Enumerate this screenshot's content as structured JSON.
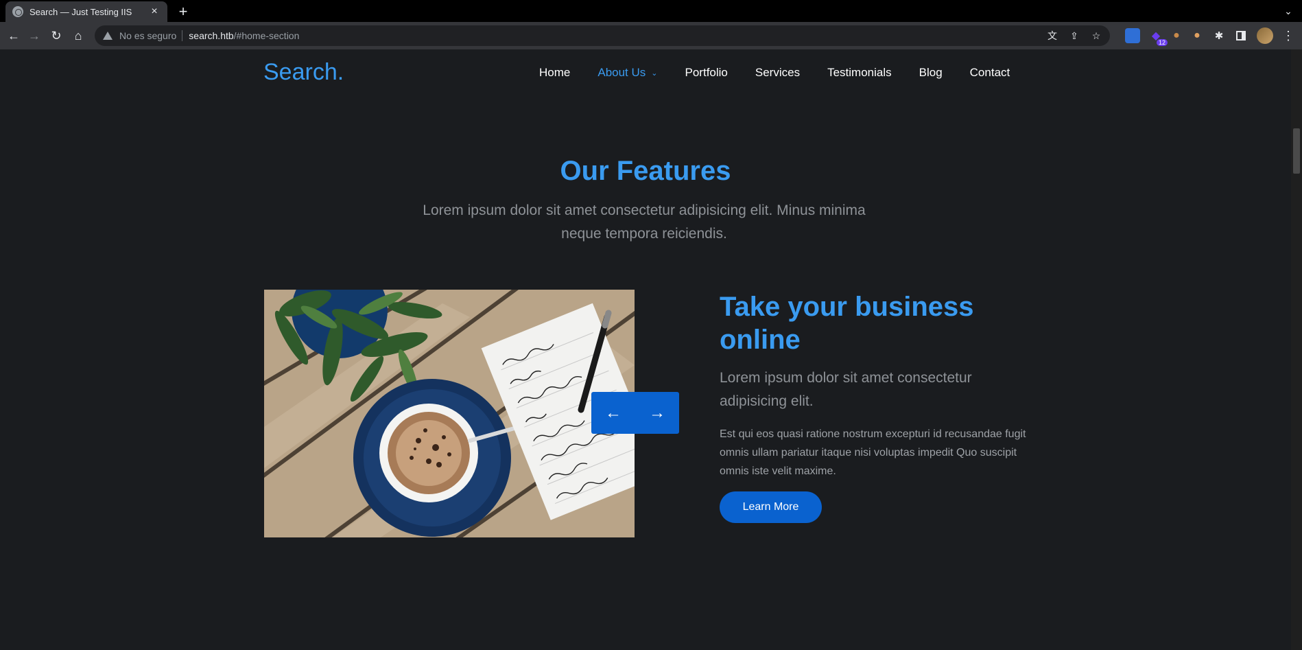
{
  "browser": {
    "tab_title": "Search — Just Testing IIS",
    "tab_close": "×",
    "new_tab": "+",
    "tab_search": "⌄",
    "back": "←",
    "forward": "→",
    "reload": "↻",
    "home": "⌂",
    "security_label": "No es seguro",
    "url_host": "search.htb",
    "url_rest": "/#home-section",
    "translate": "文",
    "share": "⇪",
    "bookmark": "☆",
    "extension_badge": "12",
    "menu": "⋮"
  },
  "site": {
    "logo": "Search.",
    "nav": [
      {
        "label": "Home"
      },
      {
        "label": "About Us"
      },
      {
        "label": "Portfolio"
      },
      {
        "label": "Services"
      },
      {
        "label": "Testimonials"
      },
      {
        "label": "Blog"
      },
      {
        "label": "Contact"
      }
    ],
    "active_nav": "About Us"
  },
  "features": {
    "title": "Our Features",
    "lead": "Lorem ipsum dolor sit amet consectetur adipisicing elit. Minus minima neque tempora reiciendis.",
    "item": {
      "title": "Take your business online",
      "subtitle": "Lorem ipsum dolor sit amet consectetur adipisicing elit.",
      "body": "Est qui eos quasi ratione nostrum excepturi id recusandae fugit omnis ullam pariatur itaque nisi voluptas impedit Quo suscipit omnis iste velit maxime.",
      "button": "Learn More"
    },
    "slider": {
      "prev": "←",
      "next": "→"
    }
  },
  "colors": {
    "accent": "#3a9bf0",
    "button": "#0a62cf",
    "background": "#1a1c1f"
  }
}
